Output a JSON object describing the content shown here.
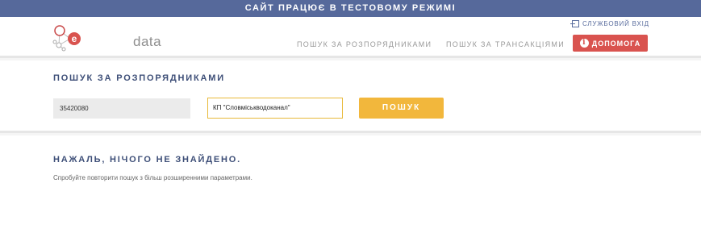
{
  "banner": {
    "text": "САЙТ ПРАЦЮЄ В ТЕСТОВОМУ РЕЖИМІ"
  },
  "header": {
    "logo_text": "data",
    "service_login": "СЛУЖБОВИЙ ВХІД",
    "nav": [
      {
        "label": "ПОШУК ЗА РОЗПОРЯДНИКАМИ"
      },
      {
        "label": "ПОШУК ЗА ТРАНСАКЦІЯМИ"
      }
    ],
    "help_label": "ДОПОМОГА"
  },
  "search": {
    "title": "ПОШУК ЗА РОЗПОРЯДНИКАМИ",
    "code_value": "35420080",
    "name_value": "КП \"Словміськводоканал\"",
    "button_label": "ПОШУК"
  },
  "result": {
    "title": "НАЖАЛЬ, НІЧОГО НЕ ЗНАЙДЕНО.",
    "text": "Спробуйте повторити пошук з більш розширенними параметрами."
  },
  "colors": {
    "banner": "#56699b",
    "accent": "#f2b73c",
    "help": "#d9534f",
    "title": "#3e4f78"
  }
}
